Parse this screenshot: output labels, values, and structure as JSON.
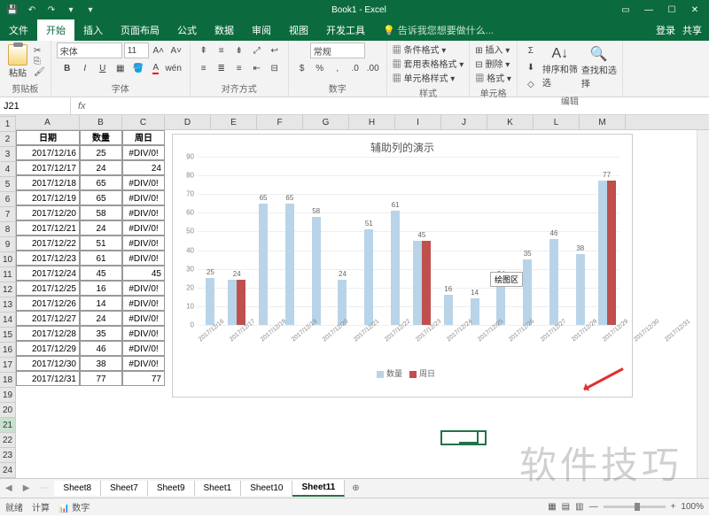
{
  "app": {
    "title": "Book1 - Excel"
  },
  "qat": [
    "save",
    "undo",
    "redo",
    "touch",
    "touch2"
  ],
  "tabs": {
    "file": "文件",
    "items": [
      "开始",
      "插入",
      "页面布局",
      "公式",
      "数据",
      "审阅",
      "视图",
      "开发工具"
    ],
    "active": 0,
    "tell": "告诉我您想要做什么...",
    "login": "登录",
    "share": "共享"
  },
  "ribbon": {
    "clipboard": {
      "paste": "粘贴",
      "label": "剪贴板"
    },
    "font": {
      "name": "宋体",
      "size": "11",
      "bold": "B",
      "italic": "I",
      "underline": "U",
      "label": "字体"
    },
    "align": {
      "label": "对齐方式"
    },
    "number": {
      "format": "常规",
      "label": "数字"
    },
    "styles": {
      "cond": "条件格式",
      "table": "套用表格格式",
      "cell": "单元格样式",
      "label": "样式"
    },
    "cells": {
      "insert": "插入",
      "delete": "删除",
      "format": "格式",
      "label": "单元格"
    },
    "editing": {
      "sort": "排序和筛选",
      "find": "查找和选择",
      "label": "编辑"
    }
  },
  "formula_bar": {
    "name": "J21",
    "fx": "fx",
    "value": ""
  },
  "columns": [
    "A",
    "B",
    "C",
    "D",
    "E",
    "F",
    "G",
    "H",
    "I",
    "J",
    "K",
    "L",
    "M"
  ],
  "col_widths": {
    "A": 72,
    "B": 48,
    "C": 48,
    "default": 52
  },
  "row_count": 24,
  "active_cell": {
    "row": 21,
    "col": "J"
  },
  "headers": {
    "A": "日期",
    "B": "数量",
    "C": "周日"
  },
  "rows": [
    {
      "A": "2017/12/16",
      "B": "25",
      "C": "#DIV/0!"
    },
    {
      "A": "2017/12/17",
      "B": "24",
      "C": "24"
    },
    {
      "A": "2017/12/18",
      "B": "65",
      "C": "#DIV/0!"
    },
    {
      "A": "2017/12/19",
      "B": "65",
      "C": "#DIV/0!"
    },
    {
      "A": "2017/12/20",
      "B": "58",
      "C": "#DIV/0!"
    },
    {
      "A": "2017/12/21",
      "B": "24",
      "C": "#DIV/0!"
    },
    {
      "A": "2017/12/22",
      "B": "51",
      "C": "#DIV/0!"
    },
    {
      "A": "2017/12/23",
      "B": "61",
      "C": "#DIV/0!"
    },
    {
      "A": "2017/12/24",
      "B": "45",
      "C": "45"
    },
    {
      "A": "2017/12/25",
      "B": "16",
      "C": "#DIV/0!"
    },
    {
      "A": "2017/12/26",
      "B": "14",
      "C": "#DIV/0!"
    },
    {
      "A": "2017/12/27",
      "B": "24",
      "C": "#DIV/0!"
    },
    {
      "A": "2017/12/28",
      "B": "35",
      "C": "#DIV/0!"
    },
    {
      "A": "2017/12/29",
      "B": "46",
      "C": "#DIV/0!"
    },
    {
      "A": "2017/12/30",
      "B": "38",
      "C": "#DIV/0!"
    },
    {
      "A": "2017/12/31",
      "B": "77",
      "C": "77"
    }
  ],
  "chart_data": {
    "type": "bar",
    "title": "辅助列的演示",
    "ylim": [
      0,
      90
    ],
    "yticks": [
      0,
      10,
      20,
      30,
      40,
      50,
      60,
      70,
      80,
      90
    ],
    "categories": [
      "2017/12/16",
      "2017/12/17",
      "2017/12/18",
      "2017/12/19",
      "2017/12/20",
      "2017/12/21",
      "2017/12/22",
      "2017/12/23",
      "2017/12/24",
      "2017/12/25",
      "2017/12/26",
      "2017/12/27",
      "2017/12/28",
      "2017/12/29",
      "2017/12/30",
      "2017/12/31"
    ],
    "series": [
      {
        "name": "数量",
        "color": "#b9d4e8",
        "values": [
          25,
          24,
          65,
          65,
          58,
          24,
          51,
          61,
          45,
          16,
          14,
          24,
          35,
          46,
          38,
          77
        ]
      },
      {
        "name": "周日",
        "color": "#c0504d",
        "values": [
          null,
          24,
          null,
          null,
          null,
          null,
          null,
          null,
          45,
          null,
          null,
          null,
          null,
          null,
          null,
          77
        ]
      }
    ],
    "tooltip": "绘图区",
    "label_source": "数量"
  },
  "sheets": {
    "items": [
      "Sheet8",
      "Sheet7",
      "Sheet9",
      "Sheet1",
      "Sheet10",
      "Sheet11"
    ],
    "active": 5
  },
  "status": {
    "mode": "就绪",
    "calc": "计算",
    "extras": "数字",
    "zoom": "100%"
  },
  "watermark": "软件技巧"
}
